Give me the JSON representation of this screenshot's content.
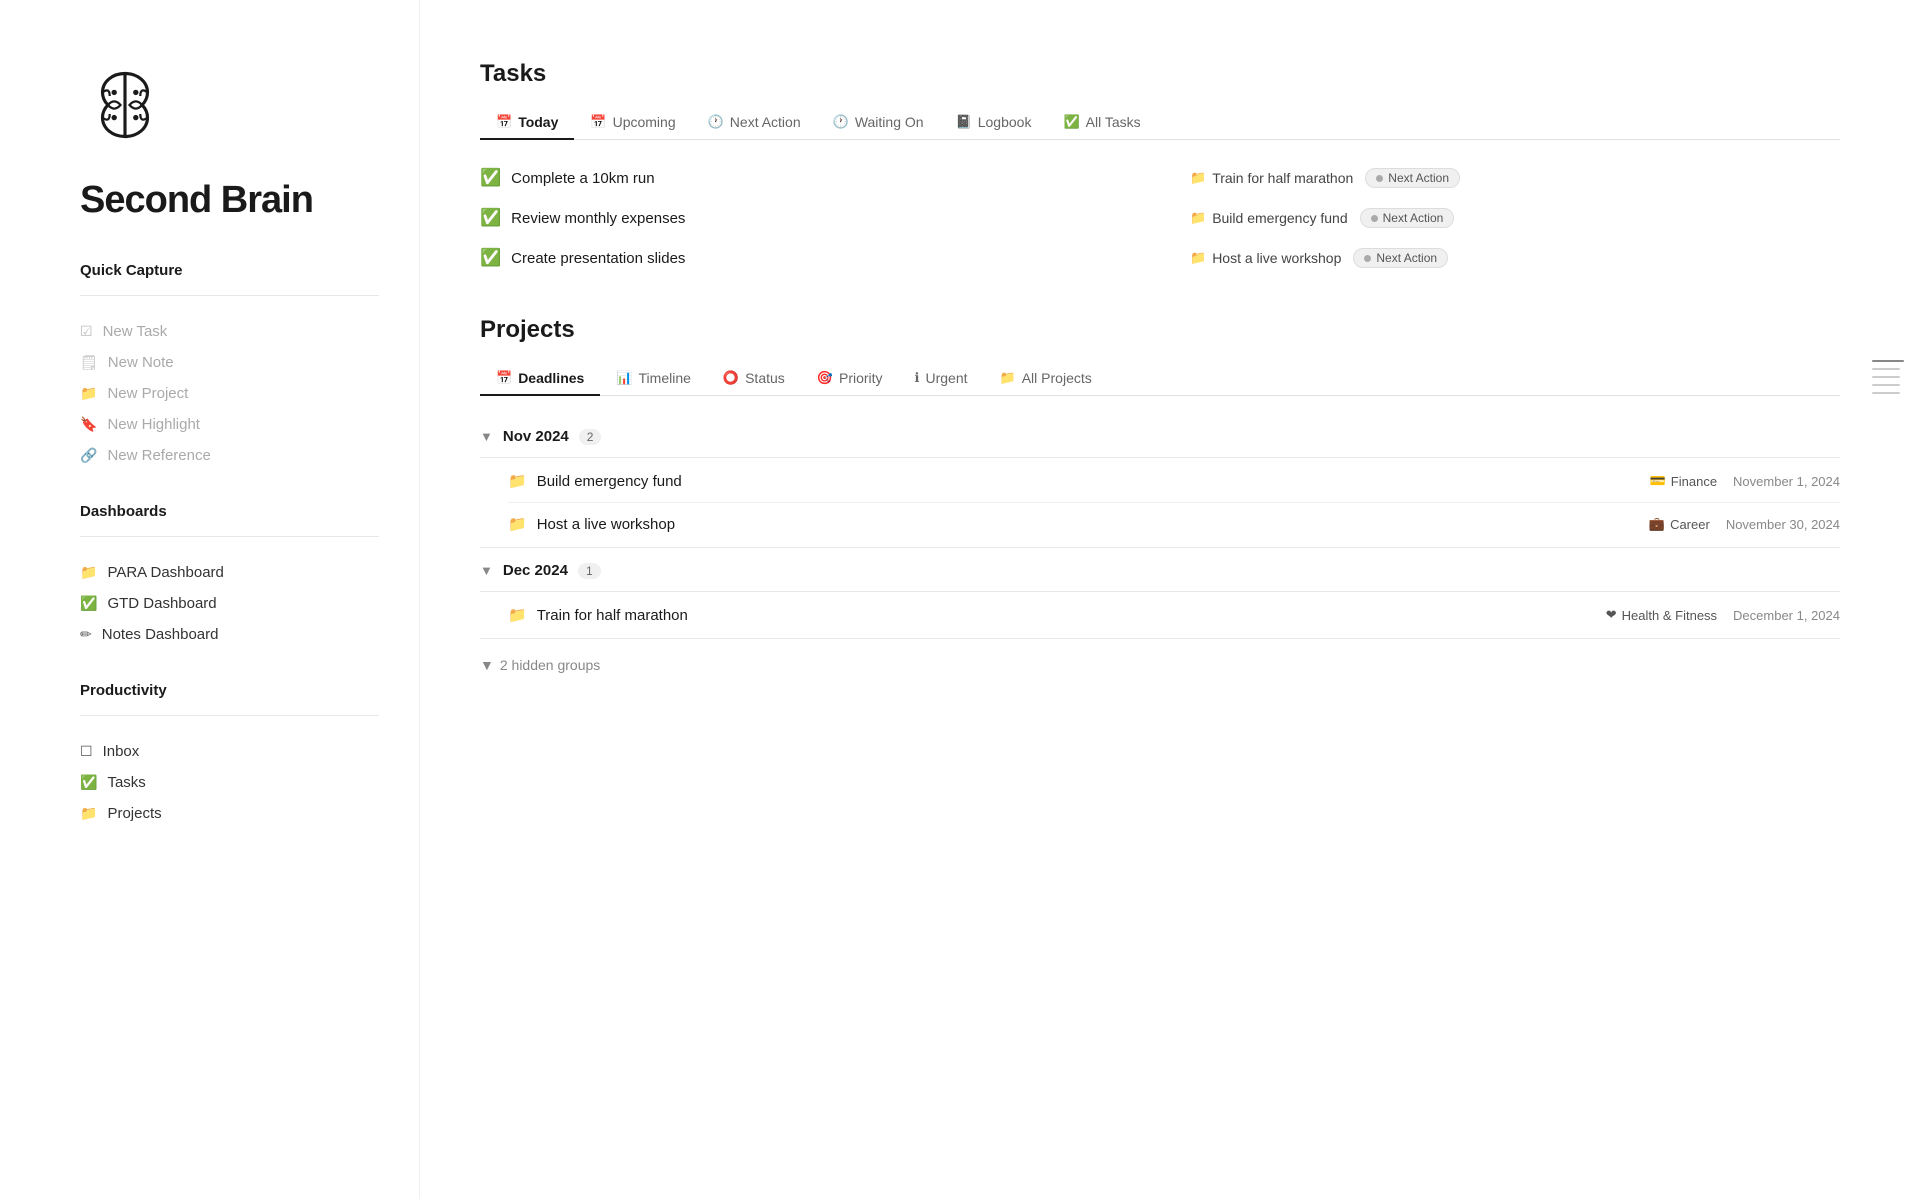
{
  "app": {
    "title": "Second Brain"
  },
  "sidebar": {
    "quick_capture_label": "Quick Capture",
    "quick_capture_items": [
      {
        "id": "new-task",
        "label": "New Task",
        "icon": "☑"
      },
      {
        "id": "new-note",
        "label": "New Note",
        "icon": "🗒"
      },
      {
        "id": "new-project",
        "label": "New Project",
        "icon": "📁"
      },
      {
        "id": "new-highlight",
        "label": "New Highlight",
        "icon": "🔖"
      },
      {
        "id": "new-reference",
        "label": "New Reference",
        "icon": "🔗"
      }
    ],
    "dashboards_label": "Dashboards",
    "dashboard_items": [
      {
        "id": "para",
        "label": "PARA Dashboard",
        "icon": "📁"
      },
      {
        "id": "gtd",
        "label": "GTD Dashboard",
        "icon": "✅"
      },
      {
        "id": "notes",
        "label": "Notes Dashboard",
        "icon": "✏"
      }
    ],
    "productivity_label": "Productivity",
    "productivity_items": [
      {
        "id": "inbox",
        "label": "Inbox",
        "icon": "☐"
      },
      {
        "id": "tasks",
        "label": "Tasks",
        "icon": "✅"
      },
      {
        "id": "projects",
        "label": "Projects",
        "icon": "📁"
      }
    ]
  },
  "tasks": {
    "section_label": "Tasks",
    "tabs": [
      {
        "id": "today",
        "label": "Today",
        "icon": "📅",
        "active": true
      },
      {
        "id": "upcoming",
        "label": "Upcoming",
        "icon": "📅"
      },
      {
        "id": "next-action",
        "label": "Next Action",
        "icon": "🕐"
      },
      {
        "id": "waiting-on",
        "label": "Waiting On",
        "icon": "🕐"
      },
      {
        "id": "logbook",
        "label": "Logbook",
        "icon": "📓"
      },
      {
        "id": "all-tasks",
        "label": "All Tasks",
        "icon": "✅"
      }
    ],
    "left_tasks": [
      {
        "label": "Complete a 10km run"
      },
      {
        "label": "Review monthly expenses"
      },
      {
        "label": "Create presentation slides"
      }
    ],
    "right_tasks": [
      {
        "project": "Train for half marathon",
        "badge": "Next Action"
      },
      {
        "project": "Build emergency fund",
        "badge": "Next Action"
      },
      {
        "project": "Host a live workshop",
        "badge": "Next Action"
      }
    ]
  },
  "projects": {
    "section_label": "Projects",
    "tabs": [
      {
        "id": "deadlines",
        "label": "Deadlines",
        "icon": "📅",
        "active": true
      },
      {
        "id": "timeline",
        "label": "Timeline",
        "icon": "📊"
      },
      {
        "id": "status",
        "label": "Status",
        "icon": "⭕"
      },
      {
        "id": "priority",
        "label": "Priority",
        "icon": "🎯"
      },
      {
        "id": "urgent",
        "label": "Urgent",
        "icon": "ℹ"
      },
      {
        "id": "all-projects",
        "label": "All Projects",
        "icon": "📁"
      }
    ],
    "groups": [
      {
        "id": "nov-2024",
        "label": "Nov 2024",
        "count": 2,
        "expanded": true,
        "items": [
          {
            "name": "Build emergency fund",
            "tag": "Finance",
            "tag_icon": "💳",
            "date": "November 1, 2024"
          },
          {
            "name": "Host a live workshop",
            "tag": "Career",
            "tag_icon": "💼",
            "date": "November 30, 2024"
          }
        ]
      },
      {
        "id": "dec-2024",
        "label": "Dec 2024",
        "count": 1,
        "expanded": true,
        "items": [
          {
            "name": "Train for half marathon",
            "tag": "Health & Fitness",
            "tag_icon": "❤",
            "date": "December 1, 2024"
          }
        ]
      }
    ],
    "hidden_groups_label": "2 hidden groups"
  },
  "scroll_bars": [
    {
      "active": true
    },
    {
      "active": false
    },
    {
      "active": false
    },
    {
      "active": false
    },
    {
      "active": false
    }
  ]
}
